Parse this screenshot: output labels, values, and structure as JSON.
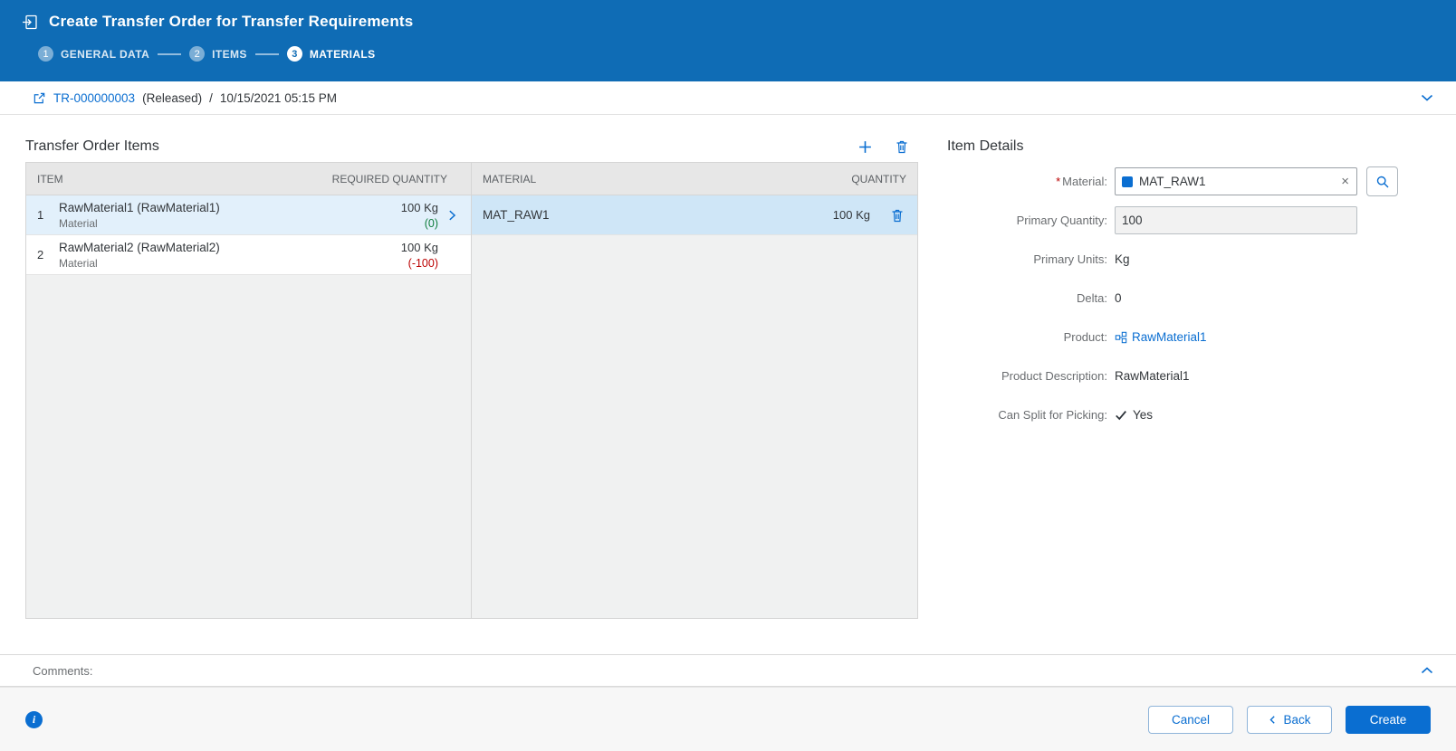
{
  "colors": {
    "accent": "#0a6ed1",
    "header_bg": "#0f6cb5",
    "positive": "#107e3e",
    "negative": "#bb0000"
  },
  "header": {
    "title": "Create Transfer Order for Transfer Requirements",
    "steps": [
      {
        "number": "1",
        "label": "GENERAL DATA"
      },
      {
        "number": "2",
        "label": "ITEMS"
      },
      {
        "number": "3",
        "label": "MATERIALS"
      }
    ]
  },
  "object_header": {
    "link": "TR-000000003",
    "status": "(Released)",
    "separator": "/",
    "timestamp": "10/15/2021 05:15 PM"
  },
  "items_panel": {
    "title": "Transfer Order Items",
    "item_columns": {
      "item": "ITEM",
      "required_quantity": "REQUIRED QUANTITY"
    },
    "material_columns": {
      "material": "MATERIAL",
      "quantity": "QUANTITY"
    },
    "items": [
      {
        "index": "1",
        "name": "RawMaterial1 (RawMaterial1)",
        "type": "Material",
        "qty": "100 Kg",
        "delta": "(0)"
      },
      {
        "index": "2",
        "name": "RawMaterial2 (RawMaterial2)",
        "type": "Material",
        "qty": "100 Kg",
        "delta": "(-100)"
      }
    ],
    "materials": [
      {
        "name": "MAT_RAW1",
        "qty": "100 Kg"
      }
    ]
  },
  "details": {
    "title": "Item Details",
    "required_marker": "*",
    "material_label": "Material:",
    "material_value": "MAT_RAW1",
    "primary_quantity_label": "Primary Quantity:",
    "primary_quantity_value": "100",
    "primary_units_label": "Primary Units:",
    "primary_units_value": "Kg",
    "delta_label": "Delta:",
    "delta_value": "0",
    "product_label": "Product:",
    "product_value": "RawMaterial1",
    "product_description_label": "Product Description:",
    "product_description_value": "RawMaterial1",
    "can_split_label": "Can Split for Picking:",
    "can_split_value": "Yes",
    "clear_glyph": "×"
  },
  "comments": {
    "label": "Comments:"
  },
  "footer": {
    "cancel_label": "Cancel",
    "back_label": "Back",
    "create_label": "Create"
  },
  "icons": {
    "transfer-order-icon": "document-with-arrow",
    "object-link-icon": "share-arrow-box",
    "collapse-header-icon": "chevron-down",
    "add-icon": "plus",
    "delete-icon": "trash",
    "row-navigate-icon": "chevron-right",
    "material-status-icon": "blue-square",
    "clear-icon": "×",
    "value-help-icon": "magnifier",
    "product-icon": "product-grid",
    "check-icon": "✓",
    "info-icon": "i",
    "expand-comments-icon": "chevron-up",
    "back-chevron-icon": "❮"
  }
}
